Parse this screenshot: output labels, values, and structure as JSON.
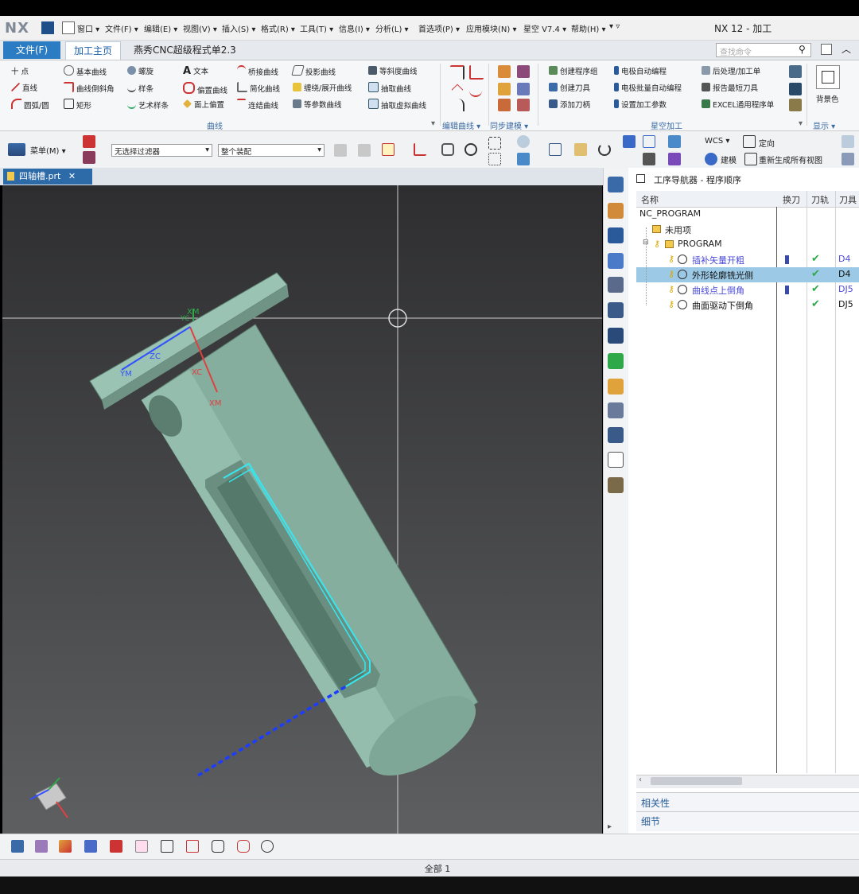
{
  "app": {
    "logo": "NX",
    "title": "NX 12 - 加工"
  },
  "menubar": [
    "窗口 ▾",
    "文件(F) ▾",
    "编辑(E) ▾",
    "视图(V) ▾",
    "插入(S) ▾",
    "格式(R) ▾",
    "工具(T) ▾",
    "信息(I) ▾",
    "分析(L) ▾",
    "首选项(P) ▾",
    "应用模块(N) ▾",
    "星空 V7.4 ▾",
    "帮助(H) ▾",
    "▾ ▿"
  ],
  "tabs": {
    "file": "文件(F)",
    "home": "加工主页",
    "cnc": "燕秀CNC超级程式单2.3"
  },
  "search_placeholder": "查找命令",
  "ribbon": {
    "curve_col1": [
      "十 点",
      "直线",
      "圆弧/圆"
    ],
    "curve_col2": [
      "基本曲线",
      "曲线倒斜角",
      "矩形"
    ],
    "curve_col3": [
      "螺旋",
      "样条",
      "艺术样条"
    ],
    "curve_col4": [
      "文本",
      "偏置曲线",
      "面上偏置"
    ],
    "curve_col5": [
      "桥接曲线",
      "简化曲线",
      "连结曲线"
    ],
    "curve_col6": [
      "投影曲线",
      "缠绕/展开曲线",
      "等参数曲线"
    ],
    "curve_col7": [
      "等斜度曲线",
      "抽取曲线",
      "抽取虚拟曲线"
    ],
    "star_col1": [
      "创建程序组",
      "创建刀具",
      "添加刀柄"
    ],
    "star_col2": [
      "电极自动编程",
      "电极批量自动编程",
      "设置加工参数"
    ],
    "star_col3": [
      "后处理/加工单",
      "报告最短刀具",
      "EXCEL通用程序单"
    ],
    "bg_label": "背景色",
    "groups": {
      "curve": "曲线",
      "edit": "编辑曲线 ▾",
      "sync": "同步建模 ▾",
      "star": "星空加工",
      "display": "显示 ▾"
    }
  },
  "toolbar2": {
    "menu": "菜单(M) ▾",
    "filter": "无选择过滤器",
    "assembly": "整个装配",
    "wcs": "WCS ▾",
    "orient": "定向",
    "build": "建模",
    "regen": "重新生成所有视图"
  },
  "doc_tab": "四轴槽.prt",
  "triad": {
    "xm": "XM",
    "yc": "YC",
    "zc": "ZC",
    "xc": "XC",
    "ym": "YM",
    "xm2": "XM"
  },
  "navigator": {
    "title": "工序导航器 - 程序顺序",
    "columns": {
      "name": "名称",
      "toolchange": "换刀",
      "path": "刀轨",
      "tool": "刀具"
    },
    "rows": [
      {
        "name": "NC_PROGRAM",
        "tool": "",
        "check": ""
      },
      {
        "name": "未用项",
        "tool": "",
        "check": ""
      },
      {
        "name": "PROGRAM",
        "tool": "",
        "check": ""
      },
      {
        "name": "插补矢量开粗",
        "tool": "D4",
        "check": "✔"
      },
      {
        "name": "外形轮廓铣光侧",
        "tool": "D4",
        "check": "✔"
      },
      {
        "name": "曲线点上倒角",
        "tool": "DJ5",
        "check": "✔"
      },
      {
        "name": "曲面驱动下倒角",
        "tool": "DJ5",
        "check": "✔"
      }
    ],
    "bottom": {
      "relevance": "相关性",
      "details": "细节"
    }
  },
  "status": "全部 1",
  "colors": {
    "accent": "#2c7cc3",
    "part": "#8fb8a8",
    "toolpath": "#36e6f0",
    "selected_row": "#9cc9e6"
  }
}
